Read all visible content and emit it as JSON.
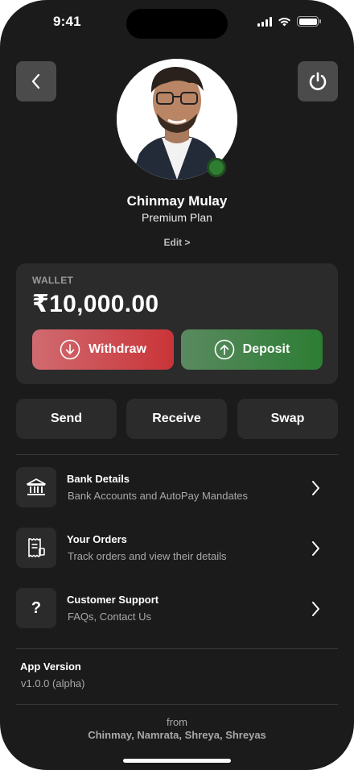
{
  "status_bar": {
    "time": "9:41"
  },
  "header": {
    "back_icon": "chevron-left-icon",
    "power_icon": "power-icon"
  },
  "profile": {
    "name": "Chinmay Mulay",
    "plan": "Premium Plan",
    "edit_label": "Edit >",
    "online": true
  },
  "wallet": {
    "label": "WALLET",
    "balance": "₹10,000.00",
    "withdraw_label": "Withdraw",
    "deposit_label": "Deposit"
  },
  "actions": {
    "send": "Send",
    "receive": "Receive",
    "swap": "Swap"
  },
  "menu": [
    {
      "icon": "bank-icon",
      "title": "Bank Details",
      "subtitle": "Bank Accounts and AutoPay Mandates"
    },
    {
      "icon": "orders-icon",
      "title": "Your Orders",
      "subtitle": "Track orders and view their details"
    },
    {
      "icon": "question-icon",
      "title": "Customer Support",
      "subtitle": "FAQs, Contact Us"
    }
  ],
  "app_version": {
    "label": "App Version",
    "value": "v1.0.0 (alpha)"
  },
  "footer": {
    "from": "from",
    "credits": "Chinmay, Namrata, Shreya, Shreyas"
  },
  "colors": {
    "background": "#1b1b1b",
    "card": "#2b2b2b",
    "withdraw": "#c93438",
    "deposit": "#2c7d33",
    "online": "#2f7d31"
  }
}
